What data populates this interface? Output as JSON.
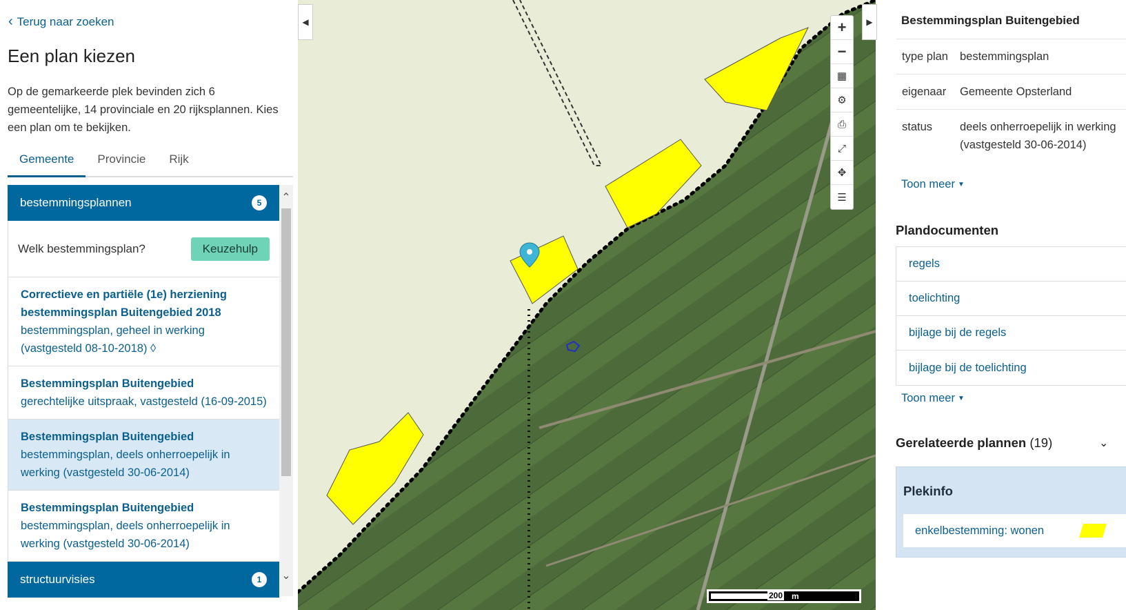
{
  "left": {
    "back_label": "Terug naar zoeken",
    "title": "Een plan kiezen",
    "intro": "Op de gemarkeerde plek bevinden zich 6 gemeentelijke, 14 provinciale en 20 rijksplannen. Kies een plan om te bekijken.",
    "tabs": [
      "Gemeente",
      "Provincie",
      "Rijk"
    ],
    "active_tab": "Gemeente",
    "accordion_bp": {
      "label": "bestemmingsplannen",
      "count": "5"
    },
    "keuze_question": "Welk bestemmingsplan?",
    "keuze_button": "Keuzehulp",
    "plans": [
      {
        "title": "Correctieve en partiële (1e) herziening bestemmingsplan Buitengebied 2018",
        "sub": "bestemmingsplan, geheel in werking (vastgesteld 08-10-2018) ◊"
      },
      {
        "title": "Bestemmingsplan Buitengebied",
        "sub": "gerechtelijke uitspraak, vastgesteld (16-09-2015)"
      },
      {
        "title": "Bestemmingsplan Buitengebied",
        "sub": "bestemmingsplan, deels onherroepelijk in werking (vastgesteld 30-06-2014)"
      },
      {
        "title": "Bestemmingsplan Buitengebied",
        "sub": "bestemmingsplan, deels onherroepelijk in werking (vastgesteld 30-06-2014)"
      }
    ],
    "accordion_sv": {
      "label": "structuurvisies",
      "count": "1"
    }
  },
  "map": {
    "scale_label": "200",
    "scale_unit": "m",
    "tools": [
      "zoom-in",
      "zoom-out",
      "layers",
      "settings",
      "print",
      "fullscreen",
      "locate",
      "legend"
    ]
  },
  "right": {
    "plan_title": "Bestemmingsplan Buitengebied",
    "info": [
      {
        "key": "type plan",
        "value": "bestemmingsplan"
      },
      {
        "key": "eigenaar",
        "value": "Gemeente Opsterland"
      },
      {
        "key": "status",
        "value": "deels onherroepelijk in werking\n(vastgesteld 30-06-2014)"
      }
    ],
    "toon_meer": "Toon meer",
    "plandocs_title": "Plandocumenten",
    "documents": [
      "regels",
      "toelichting",
      "bijlage bij de regels",
      "bijlage bij de toelichting"
    ],
    "related_title": "Gerelateerde plannen",
    "related_count": "(19)",
    "plekinfo_title": "Plekinfo",
    "plekinfo_item": "enkelbestemming: wonen"
  },
  "colors": {
    "accent": "#00689e",
    "link": "#0a5f8f",
    "keuze_button": "#6ed3b7",
    "selected_row": "#d8e9f5",
    "plan_area": "#ffff00",
    "plekinfo_bg": "#d5e4f3"
  }
}
